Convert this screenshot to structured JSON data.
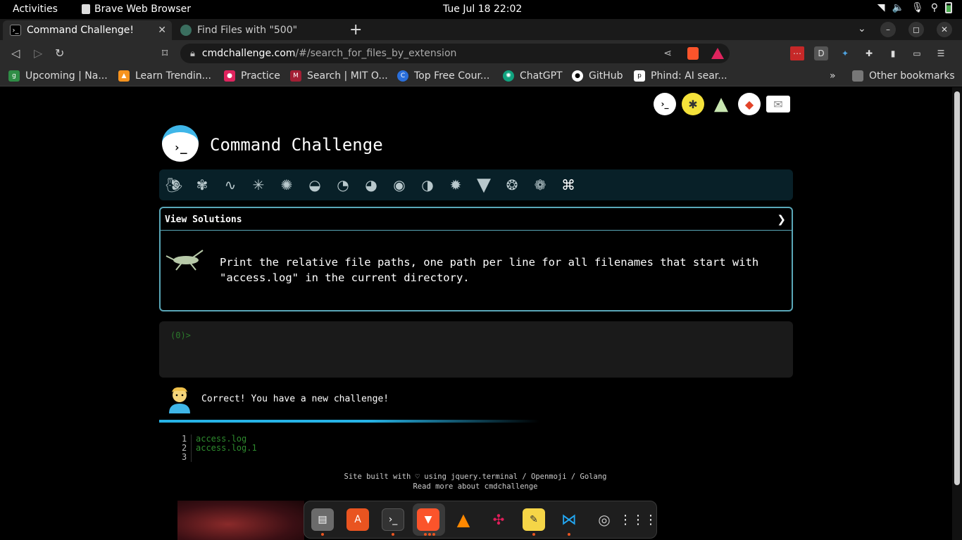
{
  "topbar": {
    "activities": "Activities",
    "app_name": "Brave Web Browser",
    "clock": "Tue Jul 18  22:02"
  },
  "tabs": [
    {
      "title": "Command Challenge!",
      "active": true
    },
    {
      "title": "Find Files with \"500\"",
      "active": false
    }
  ],
  "url": {
    "host": "cmdchallenge.com",
    "path": "/#/search_for_files_by_extension"
  },
  "bookmarks": [
    {
      "label": "Upcoming | Na...",
      "icon": "gfg-icon",
      "color": "#2f8d46"
    },
    {
      "label": "Learn Trendin...",
      "icon": "flame-icon",
      "color": "#f7931e"
    },
    {
      "label": "Practice",
      "icon": "rocket-icon",
      "color": "#e0245e"
    },
    {
      "label": "Search | MIT O...",
      "icon": "mit-icon",
      "color": "#a31f34"
    },
    {
      "label": "Top Free Cour...",
      "icon": "c-icon",
      "color": "#2a6fdb"
    },
    {
      "label": "ChatGPT",
      "icon": "chatgpt-icon",
      "color": "#10a37f"
    },
    {
      "label": "GitHub",
      "icon": "github-icon",
      "color": "#333"
    },
    {
      "label": "Phind: AI sear...",
      "icon": "phind-icon",
      "color": "#000"
    }
  ],
  "other_bookmarks": "Other bookmarks",
  "page": {
    "title": "Command Challenge",
    "view_solutions": "View Solutions",
    "challenge_text": "Print the relative file paths, one path per line for all filenames that start with \"access.log\" in the current directory.",
    "prompt": "(0)>",
    "status_message": "Correct! You have a new challenge!",
    "output": [
      {
        "line": "1",
        "text": "access.log"
      },
      {
        "line": "2",
        "text": "access.log.1"
      },
      {
        "line": "3",
        "text": ""
      }
    ],
    "footer_line1": "Site built with ♡ using jquery.terminal / Openmoji / Golang",
    "footer_line2": "Read more about cmdchallenge"
  },
  "colors": {
    "accent": "#27b3e6",
    "border": "#5aa7b8",
    "output_green": "#2e8b2e"
  }
}
